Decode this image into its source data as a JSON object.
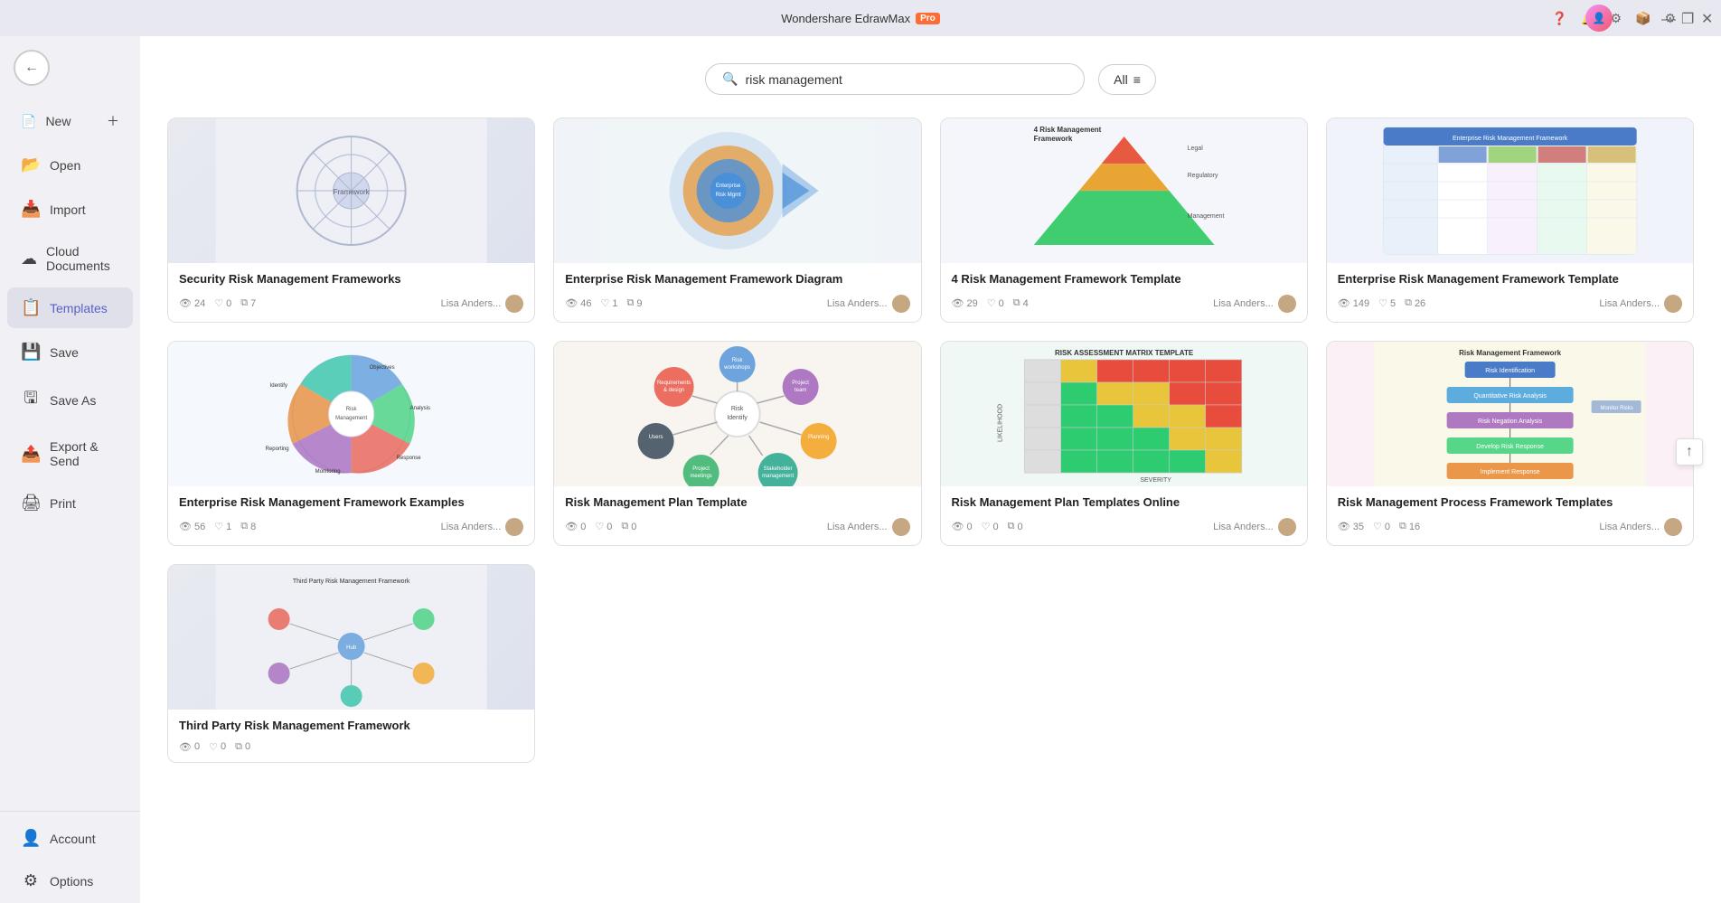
{
  "app": {
    "title": "Wondershare EdrawMax",
    "pro_badge": "Pro"
  },
  "titlebar": {
    "minimize": "—",
    "maximize": "❐",
    "close": "✕"
  },
  "topIcons": [
    "❓",
    "🔔",
    "⚙",
    "📦",
    "⚙"
  ],
  "sidebar": {
    "back_label": "←",
    "items": [
      {
        "id": "new",
        "label": "New",
        "icon": "＋",
        "has_plus": true
      },
      {
        "id": "open",
        "label": "Open",
        "icon": "📂"
      },
      {
        "id": "import",
        "label": "Import",
        "icon": "📥"
      },
      {
        "id": "cloud",
        "label": "Cloud Documents",
        "icon": "☁"
      },
      {
        "id": "templates",
        "label": "Templates",
        "icon": "📋",
        "active": true
      },
      {
        "id": "save",
        "label": "Save",
        "icon": "💾"
      },
      {
        "id": "saveas",
        "label": "Save As",
        "icon": "🖫"
      },
      {
        "id": "export",
        "label": "Export & Send",
        "icon": "📤"
      },
      {
        "id": "print",
        "label": "Print",
        "icon": "🖨"
      }
    ],
    "bottom_items": [
      {
        "id": "account",
        "label": "Account",
        "icon": "👤"
      },
      {
        "id": "options",
        "label": "Options",
        "icon": "⚙"
      }
    ]
  },
  "search": {
    "placeholder": "risk management",
    "value": "risk management",
    "filter_label": "All"
  },
  "templates": [
    {
      "id": 1,
      "title": "Security Risk Management Frameworks",
      "views": 24,
      "likes": 0,
      "copies": 7,
      "author": "Lisa Anders...",
      "preview_type": "security_risk"
    },
    {
      "id": 2,
      "title": "Enterprise Risk Management Framework Diagram",
      "views": 46,
      "likes": 1,
      "copies": 9,
      "author": "Lisa Anders...",
      "preview_type": "enterprise_circle"
    },
    {
      "id": 3,
      "title": "4 Risk Management Framework Template",
      "views": 29,
      "likes": 0,
      "copies": 4,
      "author": "Lisa Anders...",
      "preview_type": "pyramid"
    },
    {
      "id": 4,
      "title": "Enterprise Risk Management Framework Template",
      "views": 149,
      "likes": 5,
      "copies": 26,
      "author": "Lisa Anders...",
      "preview_type": "enterprise_table"
    },
    {
      "id": 5,
      "title": "Enterprise Risk Management Framework Examples",
      "views": 56,
      "likes": 1,
      "copies": 8,
      "author": "Lisa Anders...",
      "preview_type": "wheel_diagram"
    },
    {
      "id": 6,
      "title": "Risk Management Plan Template",
      "views": 0,
      "likes": 0,
      "copies": 0,
      "author": "Lisa Anders...",
      "preview_type": "bubble_map"
    },
    {
      "id": 7,
      "title": "Risk Management Plan Templates Online",
      "views": 0,
      "likes": 0,
      "copies": 0,
      "author": "Lisa Anders...",
      "preview_type": "matrix"
    },
    {
      "id": 8,
      "title": "Risk Management Process Framework Templates",
      "views": 35,
      "likes": 0,
      "copies": 16,
      "author": "Lisa Anders...",
      "preview_type": "flowchart"
    },
    {
      "id": 9,
      "title": "Third Party Risk Management Framework",
      "views": 0,
      "likes": 0,
      "copies": 0,
      "author": "",
      "preview_type": "third_party"
    }
  ],
  "icons": {
    "search": "🔍",
    "views": "👁",
    "likes": "♡",
    "copies": "⧉",
    "scroll_up": "↑"
  }
}
